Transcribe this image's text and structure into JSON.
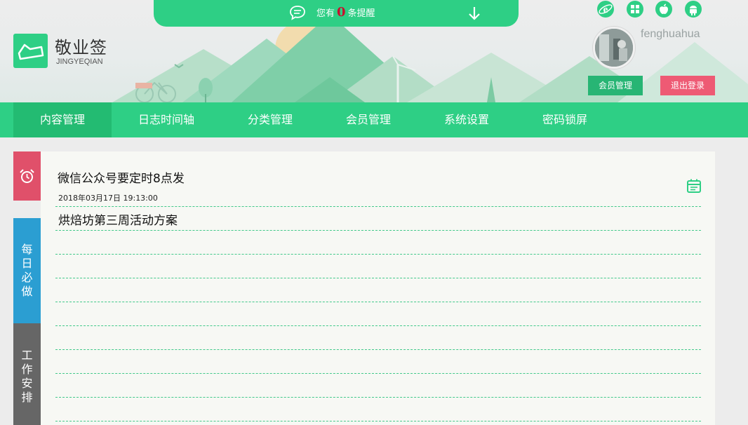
{
  "notice": {
    "prefix": "您有",
    "count": "0",
    "suffix": "条提醒"
  },
  "brand": {
    "name": "敬业签",
    "sub": "JINGYEQIAN"
  },
  "user": {
    "name": "fenghuahua"
  },
  "header_buttons": {
    "member": "会员管理",
    "logout": "退出登录"
  },
  "platform_icons": [
    "ie-icon",
    "windows-icon",
    "apple-icon",
    "android-icon"
  ],
  "nav": {
    "items": [
      {
        "label": "内容管理",
        "active": true
      },
      {
        "label": "日志时间轴"
      },
      {
        "label": "分类管理"
      },
      {
        "label": "会员管理"
      },
      {
        "label": "系统设置"
      },
      {
        "label": "密码锁屏"
      }
    ]
  },
  "side_tabs": {
    "alarm": "alarm-clock-icon",
    "daily": [
      "每",
      "日",
      "必",
      "做"
    ],
    "work": [
      "工",
      "作",
      "安",
      "排"
    ]
  },
  "notes": [
    {
      "title": "微信公众号要定时8点发",
      "date": "2018年03月17日 19:13:00"
    },
    {
      "title": "烘焙坊第三周活动方案"
    }
  ],
  "colors": {
    "primary": "#2ecf85",
    "primary_dark": "#23bb72",
    "alarm": "#e0506a",
    "daily": "#2b9ed2",
    "work": "#666666",
    "logout": "#ee5a74"
  }
}
